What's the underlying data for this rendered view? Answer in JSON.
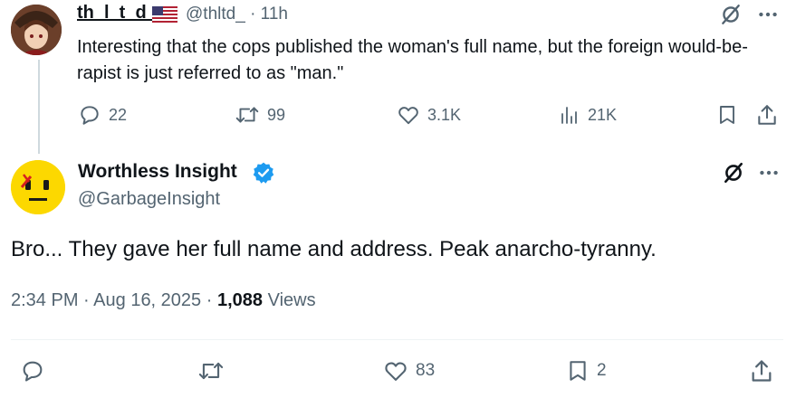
{
  "reply_tweet": {
    "display_name": "th_l_t_d_",
    "flag_icon": "us-flag-icon",
    "handle": "@thltd_",
    "separator": "·",
    "time": "11h",
    "text": "Interesting that the cops published the woman's full name, but the foreign would-be-rapist is just referred to as \"man.\"",
    "metrics": {
      "replies": "22",
      "reposts": "99",
      "likes": "3.1K",
      "views": "21K"
    }
  },
  "main_tweet": {
    "display_name": "Worthless Insight",
    "handle": "@GarbageInsight",
    "text": "Bro... They gave her full name and address. Peak anarcho-tyranny.",
    "time": "2:34 PM",
    "date": "Aug 16, 2025",
    "sep": "·",
    "views_count": "1,088",
    "views_label": "Views",
    "actions": {
      "likes": "83",
      "bookmarks": "2"
    }
  },
  "colors": {
    "text": "#0f1419",
    "muted": "#536471",
    "verified": "#1d9bf0",
    "avatar_bg": "#fcd800"
  }
}
